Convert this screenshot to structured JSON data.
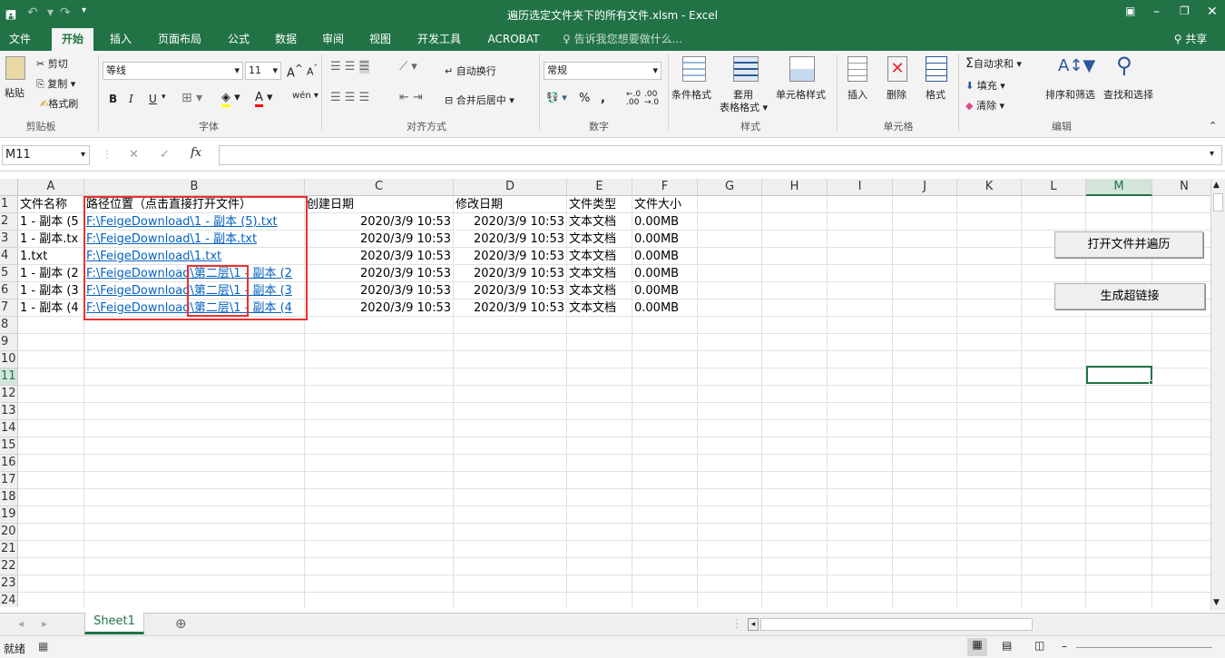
{
  "window": {
    "title": "遍历选定文件夹下的所有文件.xlsm - Excel"
  },
  "quick_access": {
    "save_icon": "save-icon",
    "undo_icon": "undo-icon",
    "redo_icon": "redo-icon",
    "customize_icon": "chevron-down-icon"
  },
  "window_controls": {
    "ribbon_options_icon": "ribbon-display-icon",
    "minimize": "–",
    "restore": "🗗",
    "close": "✕"
  },
  "tabs": [
    "文件",
    "开始",
    "插入",
    "页面布局",
    "公式",
    "数据",
    "审阅",
    "视图",
    "开发工具",
    "ACROBAT"
  ],
  "active_tab": "开始",
  "tell_me": "告诉我您想要做什么...",
  "share": "共享",
  "ribbon": {
    "clipboard": {
      "paste": "粘贴",
      "cut": "剪切",
      "copy": "复制",
      "format_painter": "格式刷",
      "group": "剪贴板"
    },
    "font": {
      "name": "等线",
      "size": "11",
      "bold": "B",
      "italic": "I",
      "underline": "U",
      "increase": "A",
      "decrease": "A",
      "phonetic": "wén",
      "group": "字体"
    },
    "alignment": {
      "wrap": "自动换行",
      "merge": "合并后居中",
      "group": "对齐方式"
    },
    "number": {
      "format": "常规",
      "percent": "%",
      "comma": ",",
      "group": "数字"
    },
    "styles": {
      "conditional": "条件格式",
      "table": "套用",
      "table2": "表格格式",
      "cell_styles": "单元格样式",
      "group": "样式"
    },
    "cells": {
      "insert": "插入",
      "delete": "删除",
      "format": "格式",
      "group": "单元格"
    },
    "editing": {
      "autosum": "自动求和",
      "fill": "填充",
      "clear": "清除",
      "sort": "排序和筛选",
      "find": "查找和选择",
      "group": "编辑"
    }
  },
  "formula_bar": {
    "name_box": "M11",
    "cancel": "✕",
    "enter": "✓",
    "fx": "fx",
    "formula": ""
  },
  "grid": {
    "columns": [
      "A",
      "B",
      "C",
      "D",
      "E",
      "F",
      "G",
      "H",
      "I",
      "J",
      "K",
      "L",
      "M",
      "N"
    ],
    "selected_column": "M",
    "row_numbers": [
      "1",
      "2",
      "3",
      "4",
      "5",
      "6",
      "7",
      "8",
      "9",
      "10",
      "11",
      "12",
      "13",
      "14",
      "15",
      "16",
      "17",
      "18",
      "19",
      "20",
      "21",
      "22",
      "23",
      "24"
    ],
    "selected_row": "11",
    "headers": {
      "a": "文件名称",
      "b": "路径位置（点击直接打开文件）",
      "c": "创建日期",
      "d": "修改日期",
      "e": "文件类型",
      "f": "文件大小"
    },
    "rows": [
      {
        "a": "1 - 副本 (5",
        "b": "F:\\FeigeDownload\\1 - 副本 (5).txt",
        "c": "2020/3/9 10:53",
        "d": "2020/3/9 10:53",
        "e": "文本文档",
        "f": "0.00MB"
      },
      {
        "a": "1 - 副本.tx",
        "b": "F:\\FeigeDownload\\1 - 副本.txt",
        "c": "2020/3/9 10:53",
        "d": "2020/3/9 10:53",
        "e": "文本文档",
        "f": "0.00MB"
      },
      {
        "a": "1.txt",
        "b": "F:\\FeigeDownload\\1.txt",
        "c": "2020/3/9 10:53",
        "d": "2020/3/9 10:53",
        "e": "文本文档",
        "f": "0.00MB"
      },
      {
        "a": "1 - 副本 (2",
        "b": "F:\\FeigeDownload\\第二层\\1 - 副本 (2",
        "c": "2020/3/9 10:53",
        "d": "2020/3/9 10:53",
        "e": "文本文档",
        "f": "0.00MB"
      },
      {
        "a": "1 - 副本 (3",
        "b": "F:\\FeigeDownload\\第二层\\1 - 副本 (3",
        "c": "2020/3/9 10:53",
        "d": "2020/3/9 10:53",
        "e": "文本文档",
        "f": "0.00MB"
      },
      {
        "a": "1 - 副本 (4",
        "b": "F:\\FeigeDownload\\第二层\\1 - 副本 (4",
        "c": "2020/3/9 10:53",
        "d": "2020/3/9 10:53",
        "e": "文本文档",
        "f": "0.00MB"
      }
    ]
  },
  "buttons": {
    "open_traverse": "打开文件并遍历",
    "make_links": "生成超链接"
  },
  "sheet_tabs": {
    "active": "Sheet1",
    "add": "⊕"
  },
  "status": {
    "ready": "就绪"
  },
  "colors": {
    "accent": "#217346",
    "link": "#0563c1",
    "highlight": "#e8312f"
  }
}
